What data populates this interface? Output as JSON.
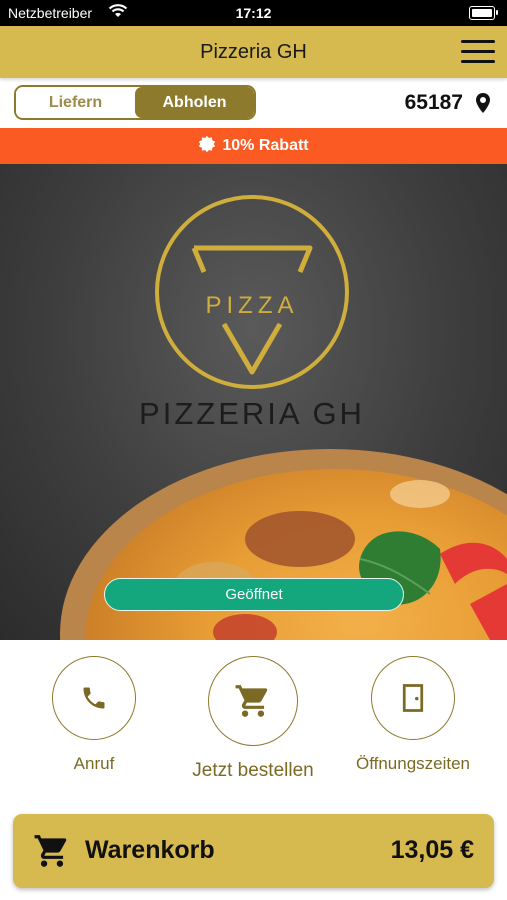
{
  "status_bar": {
    "carrier": "Netzbetreiber",
    "time": "17:12"
  },
  "header": {
    "title": "Pizzeria GH"
  },
  "order_mode": {
    "options": [
      "Liefern",
      "Abholen"
    ],
    "selected": "Abholen"
  },
  "location": {
    "zip": "65187"
  },
  "discount": {
    "text": "10% Rabatt"
  },
  "hero": {
    "logo_word": "PIZZA",
    "logo_name": "PIZZERIA GH",
    "status": "Geöffnet"
  },
  "actions": [
    {
      "label": "Anruf",
      "icon": "phone-icon"
    },
    {
      "label": "Jetzt bestellen",
      "icon": "cart-icon"
    },
    {
      "label": "Öffnungszeiten",
      "icon": "door-icon"
    }
  ],
  "cart": {
    "label": "Warenkorb",
    "total": "13,05 €"
  },
  "colors": {
    "gold": "#d6b94f",
    "dark_gold": "#8d7a2d",
    "orange": "#fb5a22",
    "green": "#14a67d"
  }
}
